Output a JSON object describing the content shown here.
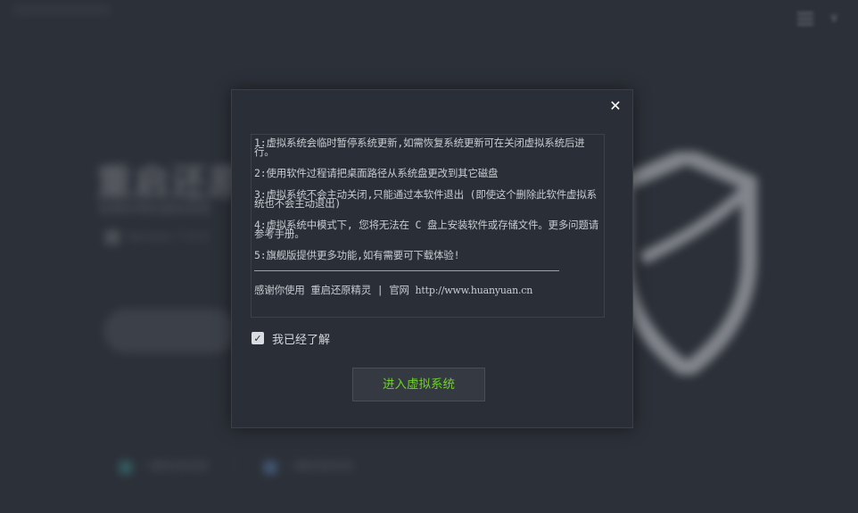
{
  "background": {
    "title": "重启还原",
    "subtitle": "免费好用的虚拟系统",
    "version": "Version 7.0.0",
    "primary_button": "进入虚拟系统",
    "link_left": "一键系统还原",
    "link_right": "一键安装系统"
  },
  "dialog": {
    "close_icon": "close-icon",
    "notice": {
      "line1": "1:虚拟系统会临时暂停系统更新,如需恢复系统更新可在关闭虚拟系统后进行。",
      "line2": "2:使用软件过程请把桌面路径从系统盘更改到其它磁盘",
      "line3": "3:虚拟系统不会主动关闭,只能通过本软件退出 (即使这个删除此软件虚拟系统也不会主动退出)",
      "line4": "4:虚拟系统中模式下, 您将无法在 C 盘上安装软件或存储文件。更多问题请参考手册。",
      "line5": "5:旗舰版提供更多功能,如有需要可下载体验!",
      "thanks": "感谢你使用 重启还原精灵 | 官网 ",
      "url": "http://www.huanyuan.cn"
    },
    "agree_label": "我已经了解",
    "agree_checked": true,
    "enter_button": "进入虚拟系统"
  },
  "colors": {
    "accent_green": "#6fcf2a",
    "background": "#2c3038"
  }
}
